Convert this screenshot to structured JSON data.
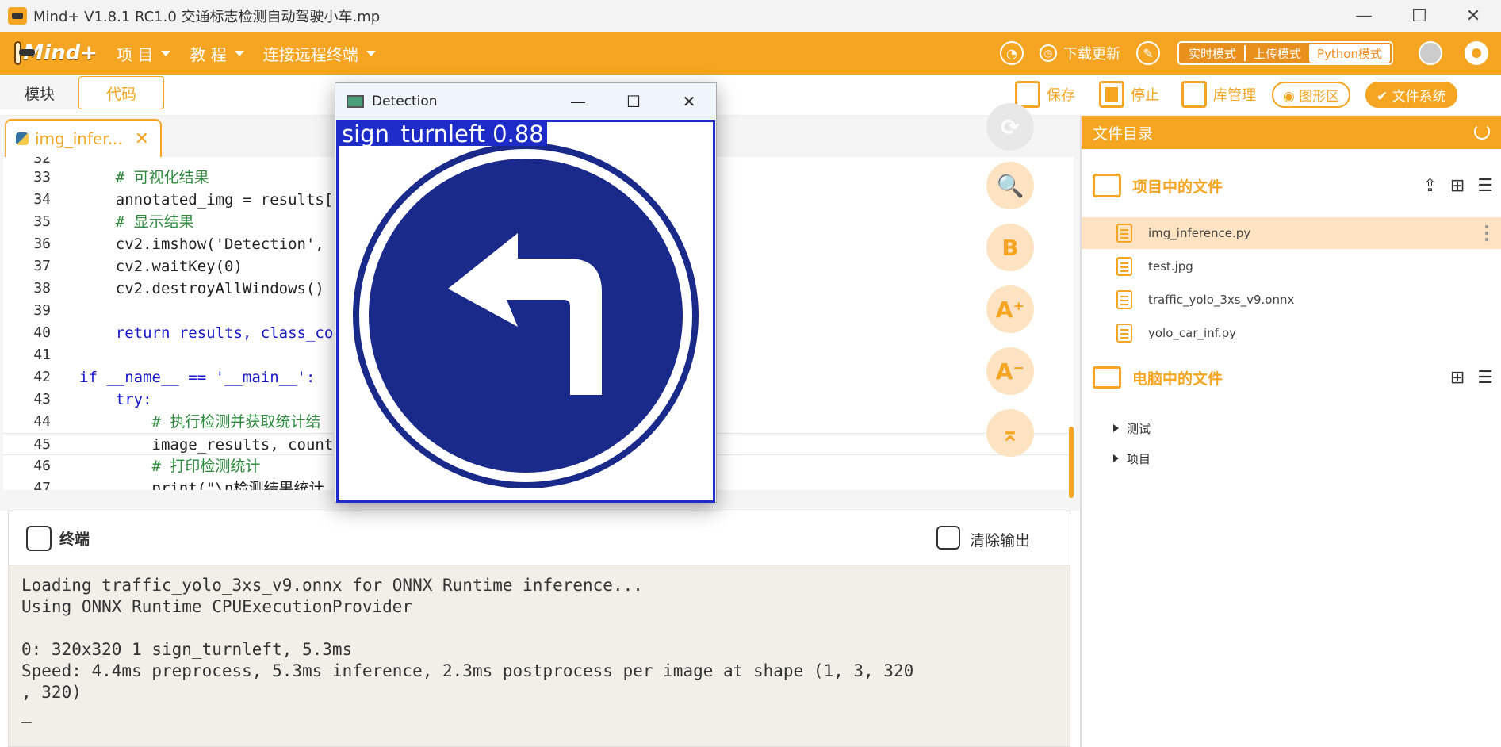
{
  "window": {
    "title": "Mind+ V1.8.1 RC1.0   交通标志检测自动驾驶小车.mp",
    "minimize": "—",
    "maximize": "☐",
    "close": "✕"
  },
  "menubar": {
    "brand": "Mind+",
    "items": [
      {
        "label": "项 目"
      },
      {
        "label": "教 程"
      },
      {
        "label": "连接远程终端"
      }
    ],
    "download_update": "下载更新",
    "modes": [
      {
        "label": "实时模式"
      },
      {
        "label": "上传模式"
      },
      {
        "label": "Python模式",
        "active": true
      }
    ]
  },
  "toolbar": {
    "tab_blocks": "模块",
    "tab_code": "代码",
    "save": "保存",
    "stop": "停止",
    "library": "库管理",
    "graphics": "图形区",
    "filesystem": "文件系统"
  },
  "editor": {
    "tab_name": "img_infer...",
    "lines": [
      {
        "n": "32",
        "text": ""
      },
      {
        "n": "33",
        "text": "    # 可视化结果"
      },
      {
        "n": "34",
        "text": "    annotated_img = results["
      },
      {
        "n": "35",
        "text": "    # 显示结果"
      },
      {
        "n": "36",
        "text": "    cv2.imshow('Detection', "
      },
      {
        "n": "37",
        "text": "    cv2.waitKey(0)"
      },
      {
        "n": "38",
        "text": "    cv2.destroyAllWindows()"
      },
      {
        "n": "39",
        "text": "    "
      },
      {
        "n": "40",
        "text": "    return results, class_co"
      },
      {
        "n": "41",
        "text": ""
      },
      {
        "n": "42",
        "text": "if __name__ == '__main__':"
      },
      {
        "n": "43",
        "text": "    try:"
      },
      {
        "n": "44",
        "text": "        # 执行检测并获取统计结"
      },
      {
        "n": "45",
        "text": "        image_results, count"
      },
      {
        "n": "46",
        "text": "        # 打印检测统计"
      },
      {
        "n": "47",
        "text": "        print(\"\\n检测结果统计"
      }
    ],
    "side_tools": [
      "⟳",
      "🔍",
      "B",
      "A⁺",
      "A⁻",
      "⌅"
    ]
  },
  "terminal": {
    "title": "终端",
    "clear": "清除输出",
    "output": "Loading traffic_yolo_3xs_v9.onnx for ONNX Runtime inference...\nUsing ONNX Runtime CPUExecutionProvider\n\n0: 320x320 1 sign_turnleft, 5.3ms\nSpeed: 4.4ms preprocess, 5.3ms inference, 2.3ms postprocess per image at shape (1, 3, 320\n, 320)\n_"
  },
  "file_panel": {
    "header": "文件目录",
    "project_section": "项目中的文件",
    "project_files": [
      {
        "name": "img_inference.py",
        "selected": true
      },
      {
        "name": "test.jpg"
      },
      {
        "name": "traffic_yolo_3xs_v9.onnx"
      },
      {
        "name": "yolo_car_inf.py"
      }
    ],
    "computer_section": "电脑中的文件",
    "computer_tree": [
      {
        "name": "测试"
      },
      {
        "name": "项目"
      }
    ]
  },
  "detection_window": {
    "title": "Detection",
    "label": "sign_turnleft  0.88",
    "sign_color": "#1a2a8a",
    "box_color": "#1d2bc8"
  },
  "colors": {
    "accent": "#f5a521",
    "accent_light": "#fde3c1"
  }
}
